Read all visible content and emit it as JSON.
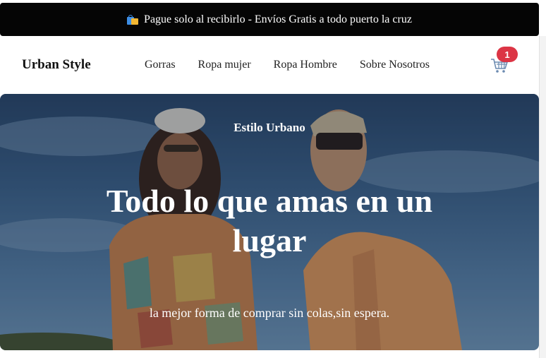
{
  "announcement": {
    "icon": "shopping-bags-icon",
    "text": "Pague solo al recibirlo - Envíos Gratis a todo puerto la cruz"
  },
  "header": {
    "brand": "Urban Style",
    "nav": [
      {
        "label": "Gorras"
      },
      {
        "label": "Ropa mujer"
      },
      {
        "label": "Ropa Hombre"
      },
      {
        "label": "Sobre Nosotros"
      }
    ],
    "cart": {
      "icon": "shopping-cart-icon",
      "count": "1"
    }
  },
  "hero": {
    "eyebrow": "Estilo Urbano",
    "headline": "Todo lo que amas en un lugar",
    "subline": "la mejor forma de comprar sin colas,sin espera."
  },
  "colors": {
    "announcement_bg": "#050505",
    "badge": "#dc3545",
    "hero_sky": "#3f6790"
  }
}
